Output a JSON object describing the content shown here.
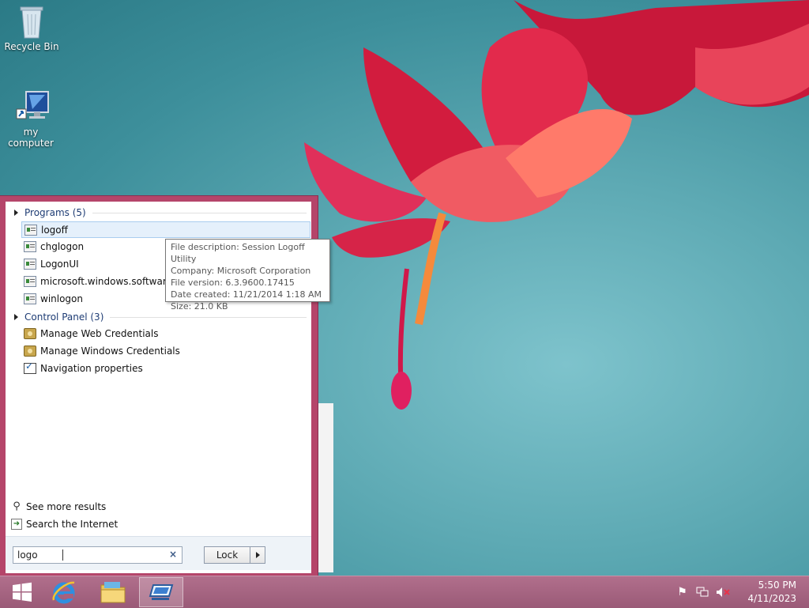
{
  "desktop": {
    "icons": [
      {
        "label": "Recycle Bin",
        "icon": "recycle-bin-icon"
      },
      {
        "label": "my computer",
        "icon": "computer-icon"
      }
    ]
  },
  "search_panel": {
    "groups": [
      {
        "header": "Programs (5)",
        "items": [
          {
            "label": "logoff",
            "selected": true
          },
          {
            "label": "chglogon"
          },
          {
            "label": "LogonUI"
          },
          {
            "label": "microsoft.windows.softwarelo"
          },
          {
            "label": "winlogon"
          }
        ]
      },
      {
        "header": "Control Panel (3)",
        "items": [
          {
            "label": "Manage Web Credentials"
          },
          {
            "label": "Manage Windows Credentials"
          },
          {
            "label": "Navigation properties"
          }
        ]
      }
    ],
    "see_more_results": "See more results",
    "search_internet": "Search the Internet",
    "search_value": "logo",
    "clear_glyph": "×",
    "lock_label": "Lock"
  },
  "tooltip": {
    "lines": [
      "File description: Session Logoff Utility",
      "Company: Microsoft Corporation",
      "File version: 6.3.9600.17415",
      "Date created: 11/21/2014 1:18 AM",
      "Size: 21.0 KB"
    ]
  },
  "taskbar": {
    "pinned": [
      "start-icon",
      "internet-explorer-icon",
      "file-explorer-icon",
      "remote-desktop-icon"
    ],
    "time": "5:50 PM",
    "date": "4/11/2023"
  }
}
